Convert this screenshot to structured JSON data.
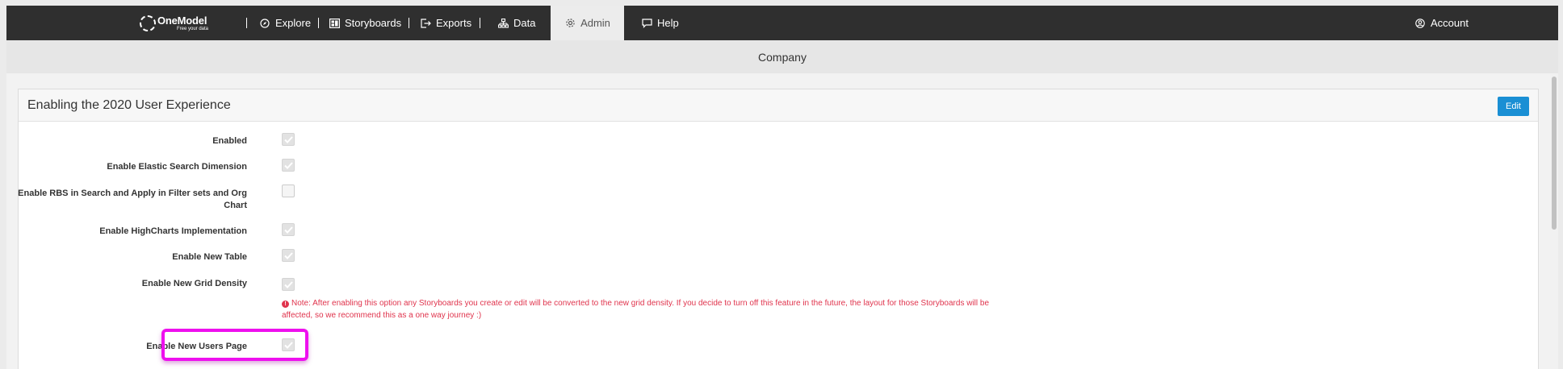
{
  "nav": {
    "logo_name": "OneModel",
    "logo_tagline": "Free your data",
    "items": [
      {
        "label": "Explore",
        "icon": "compass-icon"
      },
      {
        "label": "Storyboards",
        "icon": "storyboard-icon"
      },
      {
        "label": "Exports",
        "icon": "export-icon"
      },
      {
        "label": "Data",
        "icon": "sitemap-icon"
      },
      {
        "label": "Admin",
        "icon": "gear-icon",
        "active": true
      },
      {
        "label": "Help",
        "icon": "chat-icon"
      }
    ],
    "account_label": "Account"
  },
  "page": {
    "title": "Company"
  },
  "panel": {
    "title": "Enabling the 2020 User Experience",
    "edit_label": "Edit",
    "settings": [
      {
        "label": "Enabled",
        "checked": true
      },
      {
        "label": "Enable Elastic Search Dimension",
        "checked": true
      },
      {
        "label": "Enable RBS in Search and Apply in Filter sets and Org Chart",
        "checked": false
      },
      {
        "label": "Enable HighCharts Implementation",
        "checked": true
      },
      {
        "label": "Enable New Table",
        "checked": true
      },
      {
        "label": "Enable New Grid Density",
        "checked": true
      },
      {
        "label": "Enable New Users Page",
        "checked": true
      }
    ],
    "grid_density_note": "Note: After enabling this option any Storyboards you create or edit will be converted to the new grid density. If you decide to turn off this feature in the future, the layout for those Storyboards will be affected, so we recommend this as a one way journey :)"
  },
  "colors": {
    "nav_bg": "#2f2f2f",
    "accent": "#1a8fd4",
    "note": "#e0344d",
    "highlight": "#ee10ee"
  }
}
